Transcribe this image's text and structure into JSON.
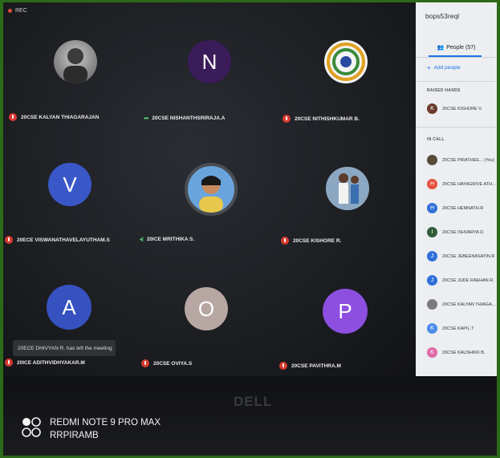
{
  "rec_label": "REC",
  "tiles": [
    {
      "name": "20CSE KALYAN THIAGARAJAN",
      "initial": "",
      "color": "#8a8a8a",
      "status": "muted"
    },
    {
      "name": "20CSE NISHANTHSRIRAJA.A",
      "initial": "N",
      "color": "#3b1c5a",
      "status": "speaking"
    },
    {
      "name": "20CSE NITHISHKUMAR B.",
      "initial": "",
      "color": "#f0f0f0",
      "status": "muted"
    },
    {
      "name": "20ECE VISWANATHAVELAYUTHAM.S",
      "initial": "V",
      "color": "#3a57c8",
      "status": "muted"
    },
    {
      "name": "20ICE MRITHIKA S.",
      "initial": "",
      "color": "#5a90c8",
      "status": "speaking"
    },
    {
      "name": "20CSE KISHORE R.",
      "initial": "",
      "color": "#6a6f79",
      "status": "muted"
    },
    {
      "name": "20ICE ADITHVIDHYAKAR.M",
      "initial": "A",
      "color": "#3651c0",
      "status": "muted"
    },
    {
      "name": "20CSE OVIYA.S",
      "initial": "O",
      "color": "#b7a7a3",
      "status": "muted"
    },
    {
      "name": "20CSE PAVITHRA.M",
      "initial": "P",
      "color": "#8c4fe0",
      "status": "muted"
    }
  ],
  "toast": "20ECE DHIVYAN R. has left the meeting",
  "panel": {
    "meeting_code": "bops53reql",
    "people_tab": "People (57)",
    "add_people": "Add people",
    "raised_hands_header": "RAISED HANDS",
    "raised_hands": [
      {
        "initial": "K",
        "name": "20CSE KISHORE V.",
        "color": "#6b3a2a"
      }
    ],
    "in_call_header": "IN CALL",
    "in_call": [
      {
        "initial": "",
        "name": "20CSE PIRATHEE... (You)",
        "color": "#5a4a3a"
      },
      {
        "initial": "H",
        "name": "20CSE HAYAGRIVE ATH...",
        "color": "#e5503f"
      },
      {
        "initial": "H",
        "name": "20CSE HEMNATH.R",
        "color": "#2f6fd8"
      },
      {
        "initial": "I",
        "name": "20CSE ISHVARYA D.",
        "color": "#2f5d3a"
      },
      {
        "initial": "J",
        "name": "20CSE JEBEENASATIN.R",
        "color": "#2f6fd8"
      },
      {
        "initial": "J",
        "name": "20CSE JUDE RAEHAN R.",
        "color": "#2f6fd8"
      },
      {
        "initial": "",
        "name": "20CSE KALYAN THIAGA...",
        "color": "#7a7a7a"
      },
      {
        "initial": "K",
        "name": "20CSE KAPIL.T",
        "color": "#4a8bea"
      },
      {
        "initial": "K",
        "name": "20CSE KAUSHIKK B.",
        "color": "#e06aa8"
      }
    ]
  },
  "laptop_brand": "DELL",
  "watermark": {
    "line1": "REDMI NOTE 9 PRO MAX",
    "line2": "RRPIRAMB"
  }
}
